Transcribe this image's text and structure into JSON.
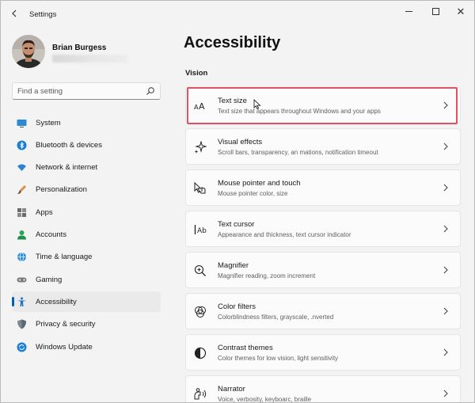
{
  "window": {
    "title": "Settings"
  },
  "user": {
    "name": "Brian Burgess"
  },
  "search": {
    "placeholder": "Find a setting"
  },
  "nav": {
    "items": [
      {
        "label": "System",
        "icon": "monitor-icon"
      },
      {
        "label": "Bluetooth & devices",
        "icon": "bluetooth-icon"
      },
      {
        "label": "Network & internet",
        "icon": "wifi-icon"
      },
      {
        "label": "Personalization",
        "icon": "brush-icon"
      },
      {
        "label": "Apps",
        "icon": "apps-grid-icon"
      },
      {
        "label": "Accounts",
        "icon": "person-icon"
      },
      {
        "label": "Time & language",
        "icon": "globe-clock-icon"
      },
      {
        "label": "Gaming",
        "icon": "gamepad-icon"
      },
      {
        "label": "Accessibility",
        "icon": "accessibility-icon",
        "active": true
      },
      {
        "label": "Privacy & security",
        "icon": "shield-icon"
      },
      {
        "label": "Windows Update",
        "icon": "update-icon"
      }
    ]
  },
  "main": {
    "title": "Accessibility",
    "section": "Vision",
    "cards": [
      {
        "title": "Text size",
        "desc": "Text size that appears throughout Windows and your apps",
        "icon": "text-size-icon",
        "highlighted": true
      },
      {
        "title": "Visual effects",
        "desc": "Scroll bars, transparency, an mations, notification timeout",
        "icon": "sparkle-icon"
      },
      {
        "title": "Mouse pointer and touch",
        "desc": "Mouse pointer color, size",
        "icon": "pointer-touch-icon"
      },
      {
        "title": "Text cursor",
        "desc": "Appearance and thickness, text cursor indicator",
        "icon": "text-cursor-icon"
      },
      {
        "title": "Magnifier",
        "desc": "Magnifier reading, zoom increment",
        "icon": "magnifier-icon"
      },
      {
        "title": "Color filters",
        "desc": "Colorblindness filters, grayscale, .nverted",
        "icon": "color-filter-icon"
      },
      {
        "title": "Contrast themes",
        "desc": "Color themes for low vision, light sensitivity",
        "icon": "contrast-icon"
      },
      {
        "title": "Narrator",
        "desc": "Voice, verbosity, keyboarc, braille",
        "icon": "narrator-icon"
      }
    ]
  },
  "colors": {
    "accent": "#005fb8",
    "highlight": "#e3505f",
    "background": "#f3f3f3",
    "card": "#fbfbfb"
  }
}
